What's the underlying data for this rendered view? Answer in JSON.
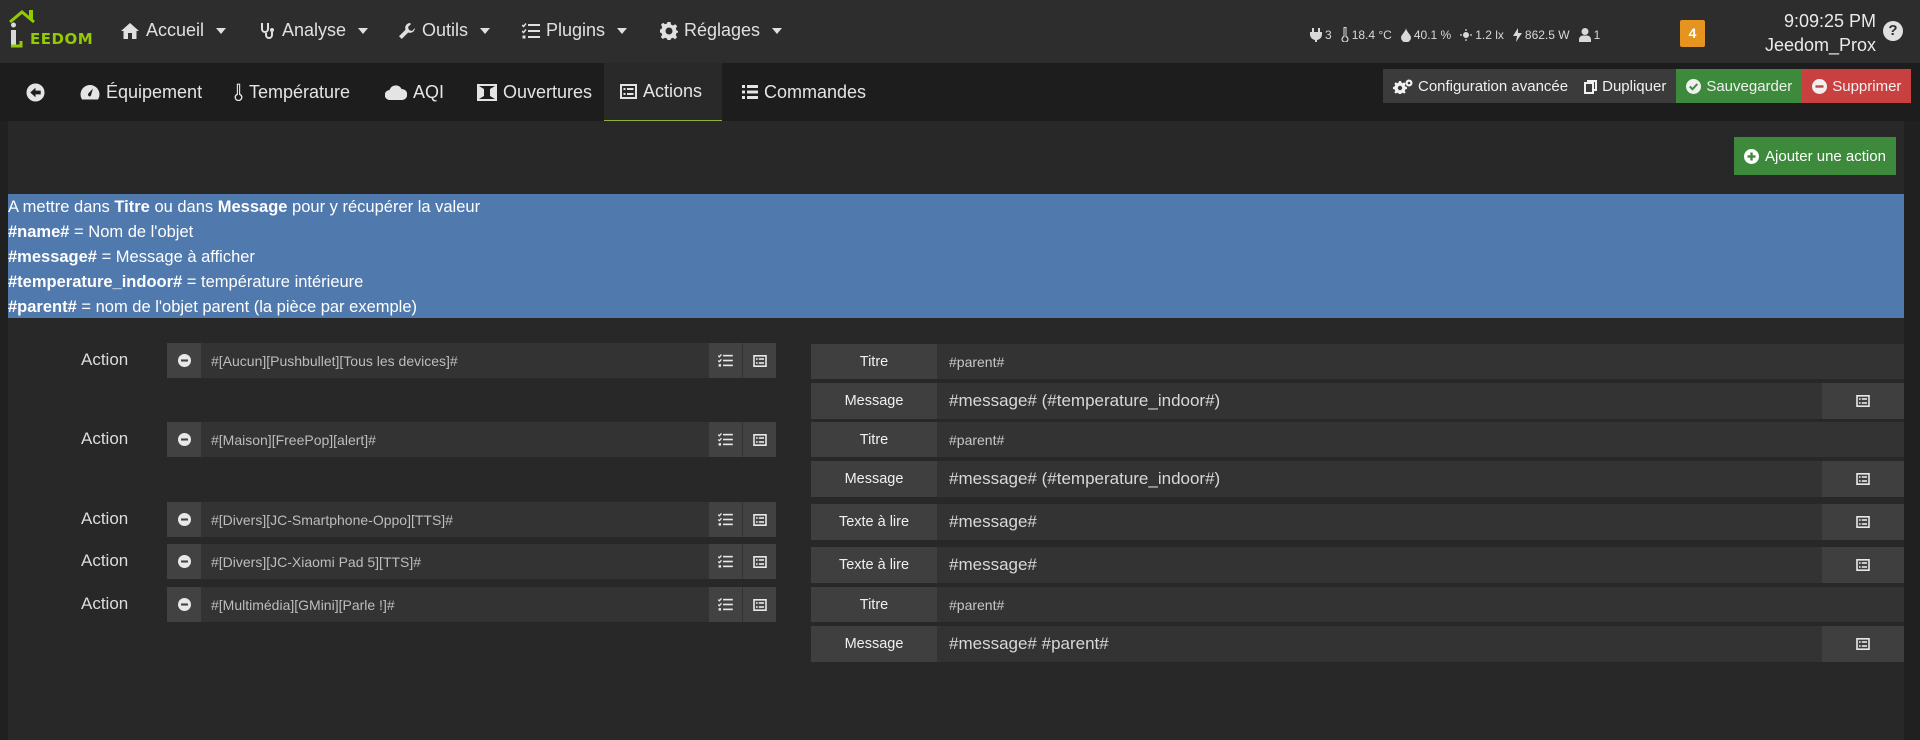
{
  "navbar": {
    "logo_text": "EEDOM",
    "menus": [
      {
        "label": "Accueil",
        "icon": "home-icon"
      },
      {
        "label": "Analyse",
        "icon": "stethoscope-icon"
      },
      {
        "label": "Outils",
        "icon": "wrench-icon"
      },
      {
        "label": "Plugins",
        "icon": "tasks-icon"
      },
      {
        "label": "Réglages",
        "icon": "cog-icon"
      }
    ],
    "stats": [
      {
        "icon": "plug-icon",
        "value": "3"
      },
      {
        "icon": "thermometer-icon",
        "value": "18.4 °C"
      },
      {
        "icon": "drop-icon",
        "value": "40.1 %"
      },
      {
        "icon": "sun-icon",
        "value": "1.2 lx"
      },
      {
        "icon": "bolt-icon",
        "value": "862.5 W"
      },
      {
        "icon": "user-icon",
        "value": "1"
      }
    ],
    "message_count": "4",
    "time": "9:09:25 PM",
    "hostname": "Jeedom_Prox",
    "help": "?"
  },
  "tabs": [
    {
      "label": "",
      "icon": "back-arrow-icon"
    },
    {
      "label": "Équipement",
      "icon": "tachometer-icon"
    },
    {
      "label": "Température",
      "icon": "thermometer-icon"
    },
    {
      "label": "AQI",
      "icon": "cloud-icon"
    },
    {
      "label": "Ouvertures",
      "icon": "window-icon"
    },
    {
      "label": "Actions",
      "icon": "list-alt-icon"
    },
    {
      "label": "Commandes",
      "icon": "list-icon"
    }
  ],
  "toolbar": {
    "config": "Configuration avancée",
    "duplicate": "Dupliquer",
    "save": "Sauvegarder",
    "delete": "Supprimer",
    "colors": {
      "default": "#3b3b3b",
      "save": "#3d8a3d",
      "delete": "#c94040"
    }
  },
  "add_action": "Ajouter une action",
  "info": {
    "line1": {
      "pre": "A mettre dans ",
      "b1": "Titre",
      "mid": " ou dans ",
      "b2": "Message",
      "post": " pour y récupérer la valeur"
    },
    "vars": [
      {
        "name": "#name#",
        "desc": " = Nom de l'objet"
      },
      {
        "name": "#message#",
        "desc": " = Message à afficher"
      },
      {
        "name": "#temperature_indoor#",
        "desc": " = température intérieure"
      },
      {
        "name": "#parent#",
        "desc": " = nom de l'objet parent (la pièce par exemple)"
      }
    ]
  },
  "actions": [
    {
      "label": "Action",
      "cmd": "#[Aucun][Pushbullet][Tous les devices]#"
    },
    {
      "label": "Action",
      "cmd": "#[Maison][FreePop][alert]#"
    },
    {
      "label": "Action",
      "cmd": "#[Divers][JC-Smartphone-Oppo][TTS]#"
    },
    {
      "label": "Action",
      "cmd": "#[Divers][JC-Xiaomi Pad 5][TTS]#"
    },
    {
      "label": "Action",
      "cmd": "#[Multimédia][GMini][Parle !]#"
    }
  ],
  "options": [
    {
      "label": "Titre",
      "value": "#parent#"
    },
    {
      "label": "Message",
      "value": "#message#  (#temperature_indoor#)"
    },
    {
      "label": "Titre",
      "value": "#parent#"
    },
    {
      "label": "Message",
      "value": "#message#  (#temperature_indoor#)"
    },
    {
      "label": "Texte à lire",
      "value": "#message#"
    },
    {
      "label": "Texte à lire",
      "value": "#message#"
    },
    {
      "label": "Titre",
      "value": "#parent#"
    },
    {
      "label": "Message",
      "value": "#message# #parent#"
    }
  ]
}
